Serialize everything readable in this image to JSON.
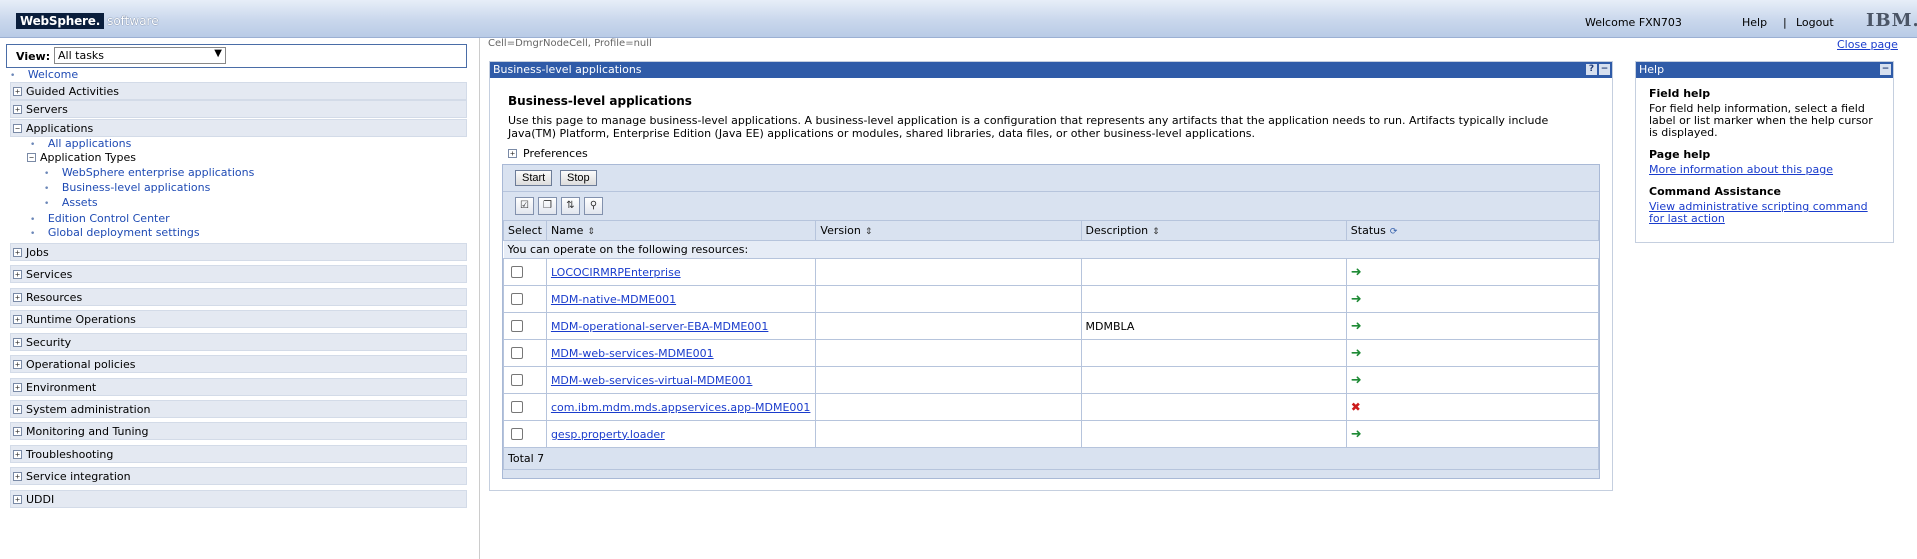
{
  "header": {
    "brand_main": "WebSphere.",
    "brand_sub": "software",
    "welcome": "Welcome FXN703",
    "help": "Help",
    "separator": "|",
    "logout": "Logout",
    "logo": "IBM."
  },
  "nav": {
    "view_label": "View:",
    "view_value": "All tasks",
    "welcome": "Welcome",
    "categories": [
      "Guided Activities",
      "Servers",
      "Applications",
      "Jobs",
      "Services",
      "Resources",
      "Runtime Operations",
      "Security",
      "Operational policies",
      "Environment",
      "System administration",
      "Monitoring and Tuning",
      "Troubleshooting",
      "Service integration",
      "UDDI"
    ],
    "applications_children": {
      "all_applications": "All applications",
      "application_types": "Application Types",
      "websphere_enterprise": "WebSphere enterprise applications",
      "business_level": "Business-level applications",
      "assets": "Assets",
      "edition_control": "Edition Control Center",
      "global_deployment": "Global deployment settings"
    }
  },
  "crumb": {
    "cell": "Cell=DmgrNodeCell, Profile=null",
    "close_page": "Close page"
  },
  "main": {
    "panel_title": "Business-level applications",
    "heading": "Business-level applications",
    "description": "Use this page to manage business-level applications. A business-level application is a configuration that represents any artifacts that the application needs to run. Artifacts typically include Java(TM) Platform, Enterprise Edition (Java EE) applications or modules, shared libraries, data files, or other business-level applications.",
    "preferences": "Preferences",
    "start_button": "Start",
    "stop_button": "Stop",
    "columns": [
      "Select",
      "Name",
      "Version",
      "Description",
      "Status"
    ],
    "info_row": "You can operate on the following resources:",
    "rows": [
      {
        "name": "LOCOCIRMRPEnterprise",
        "version": "",
        "description": "",
        "status": "running"
      },
      {
        "name": "MDM-native-MDME001",
        "version": "",
        "description": "",
        "status": "running"
      },
      {
        "name": "MDM-operational-server-EBA-MDME001",
        "version": "",
        "description": "MDMBLA",
        "status": "running"
      },
      {
        "name": "MDM-web-services-MDME001",
        "version": "",
        "description": "",
        "status": "running"
      },
      {
        "name": "MDM-web-services-virtual-MDME001",
        "version": "",
        "description": "",
        "status": "running"
      },
      {
        "name": "com.ibm.mdm.mds.appservices.app-MDME001",
        "version": "",
        "description": "",
        "status": "stopped"
      },
      {
        "name": "gesp.property.loader",
        "version": "",
        "description": "",
        "status": "running"
      }
    ],
    "total": "Total 7"
  },
  "help": {
    "panel_title": "Help",
    "field_help_title": "Field help",
    "field_help_text": "For field help information, select a field label or list marker when the help cursor is displayed.",
    "page_help_title": "Page help",
    "page_help_link": "More information about this page",
    "command_title": "Command Assistance",
    "command_link": "View administrative scripting command for last action"
  },
  "colors": {
    "panel_title_bg": "#2f5ba8",
    "link": "#1a3ccc",
    "running": "#1e8a35",
    "stopped": "#cc1b1b"
  }
}
